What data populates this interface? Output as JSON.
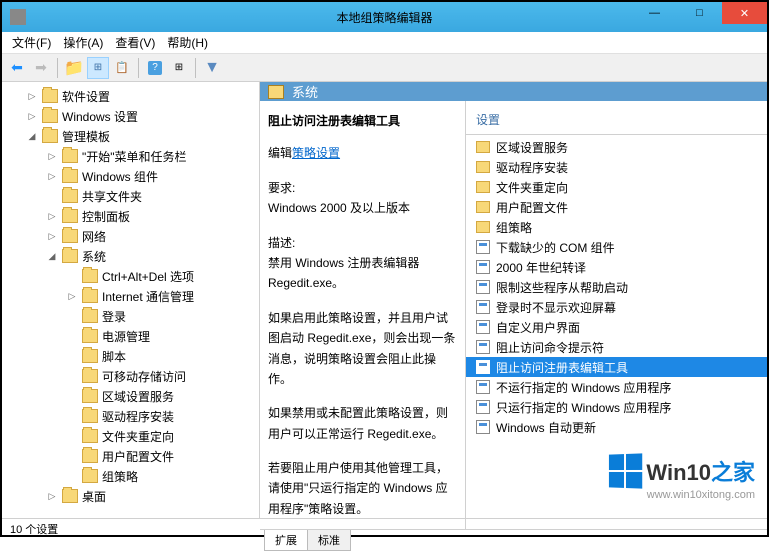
{
  "window": {
    "title": "本地组策略编辑器"
  },
  "menu": {
    "file": "文件(F)",
    "action": "操作(A)",
    "view": "查看(V)",
    "help": "帮助(H)"
  },
  "tree": [
    {
      "label": "软件设置",
      "indent": 1,
      "exp": "▷"
    },
    {
      "label": "Windows 设置",
      "indent": 1,
      "exp": "▷"
    },
    {
      "label": "管理模板",
      "indent": 1,
      "exp": "◢"
    },
    {
      "label": "\"开始\"菜单和任务栏",
      "indent": 2,
      "exp": "▷"
    },
    {
      "label": "Windows 组件",
      "indent": 2,
      "exp": "▷"
    },
    {
      "label": "共享文件夹",
      "indent": 2,
      "exp": ""
    },
    {
      "label": "控制面板",
      "indent": 2,
      "exp": "▷"
    },
    {
      "label": "网络",
      "indent": 2,
      "exp": "▷"
    },
    {
      "label": "系统",
      "indent": 2,
      "exp": "◢"
    },
    {
      "label": "Ctrl+Alt+Del 选项",
      "indent": 3,
      "exp": ""
    },
    {
      "label": "Internet 通信管理",
      "indent": 3,
      "exp": "▷"
    },
    {
      "label": "登录",
      "indent": 3,
      "exp": ""
    },
    {
      "label": "电源管理",
      "indent": 3,
      "exp": ""
    },
    {
      "label": "脚本",
      "indent": 3,
      "exp": ""
    },
    {
      "label": "可移动存储访问",
      "indent": 3,
      "exp": ""
    },
    {
      "label": "区域设置服务",
      "indent": 3,
      "exp": ""
    },
    {
      "label": "驱动程序安装",
      "indent": 3,
      "exp": ""
    },
    {
      "label": "文件夹重定向",
      "indent": 3,
      "exp": ""
    },
    {
      "label": "用户配置文件",
      "indent": 3,
      "exp": ""
    },
    {
      "label": "组策略",
      "indent": 3,
      "exp": ""
    },
    {
      "label": "桌面",
      "indent": 2,
      "exp": "▷"
    }
  ],
  "header": {
    "title": "系统"
  },
  "desc": {
    "title": "阻止访问注册表编辑工具",
    "edit_prefix": "编辑",
    "edit_link": "策略设置",
    "req_label": "要求:",
    "req_value": "Windows 2000 及以上版本",
    "desc_label": "描述:",
    "desc_p1": "禁用 Windows 注册表编辑器 Regedit.exe。",
    "desc_p2": "如果启用此策略设置，并且用户试图启动 Regedit.exe，则会出现一条消息，说明策略设置会阻止此操作。",
    "desc_p3": "如果禁用或未配置此策略设置，则用户可以正常运行 Regedit.exe。",
    "desc_p4": "若要阻止用户使用其他管理工具，请使用\"只运行指定的 Windows 应用程序\"策略设置。"
  },
  "list": {
    "header": "设置",
    "items": [
      "区域设置服务",
      "驱动程序安装",
      "文件夹重定向",
      "用户配置文件",
      "组策略",
      "下载缺少的 COM 组件",
      "2000 年世纪转译",
      "限制这些程序从帮助启动",
      "登录时不显示欢迎屏幕",
      "自定义用户界面",
      "阻止访问命令提示符",
      "阻止访问注册表编辑工具",
      "不运行指定的 Windows 应用程序",
      "只运行指定的 Windows 应用程序",
      "Windows 自动更新"
    ],
    "folder_count": 5,
    "selected": 11
  },
  "tabs": {
    "ext": "扩展",
    "std": "标准"
  },
  "status": "10 个设置",
  "watermark": {
    "brand_en": "Win10",
    "brand_zh": "之家",
    "url": "www.win10xitong.com"
  }
}
